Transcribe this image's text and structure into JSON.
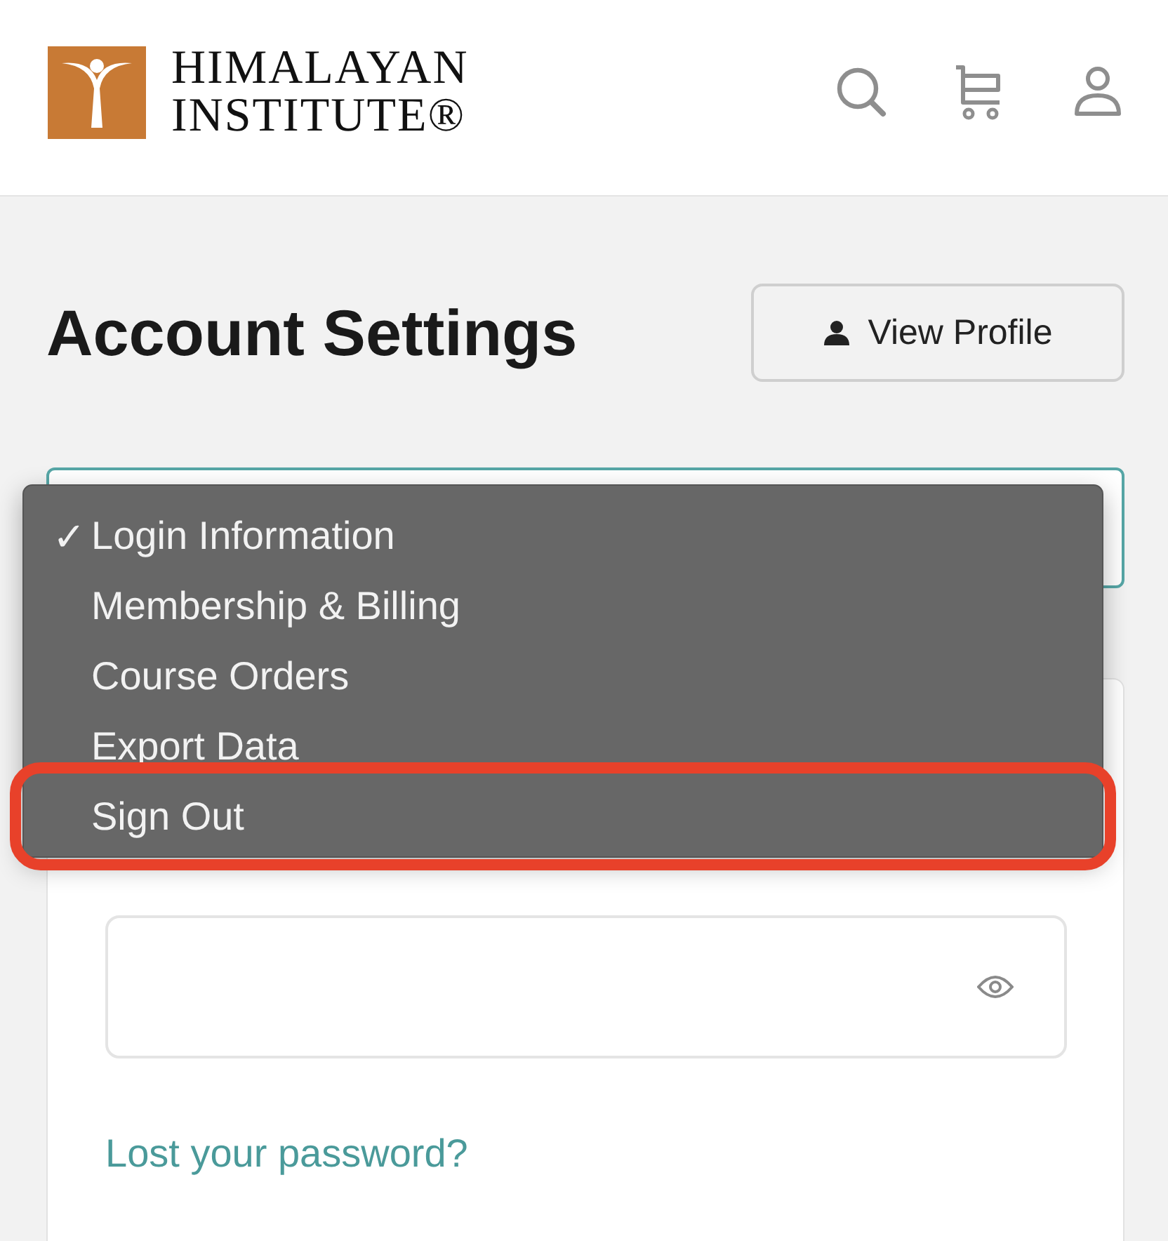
{
  "header": {
    "logo_line_1": "HIMALAYAN",
    "logo_line_2": "INSTITUTE®"
  },
  "page_title": "Account Settings",
  "view_profile_button": "View Profile",
  "section_menu": {
    "items": [
      {
        "label": "Login Information",
        "selected": true,
        "annotated": false
      },
      {
        "label": "Membership & Billing",
        "selected": false,
        "annotated": false
      },
      {
        "label": "Course Orders",
        "selected": false,
        "annotated": false
      },
      {
        "label": "Export Data",
        "selected": false,
        "annotated": false
      },
      {
        "label": "Sign Out",
        "selected": false,
        "annotated": true
      }
    ]
  },
  "check_mark": "✓",
  "lost_password_link": "Lost your password?"
}
